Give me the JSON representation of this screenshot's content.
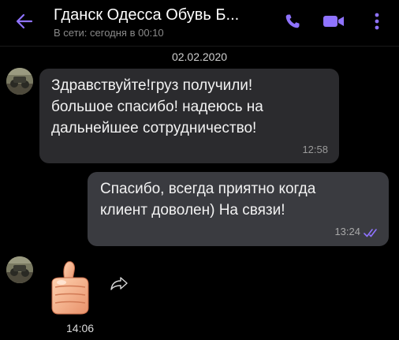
{
  "header": {
    "title": "Гданск Одесса Обувь Б...",
    "status": "В сети: сегодня в 00:10",
    "back_icon": "arrow-left-icon",
    "call_icon": "phone-icon",
    "video_icon": "video-camera-icon",
    "menu_icon": "more-vertical-icon"
  },
  "chat": {
    "date_separator": "02.02.2020",
    "messages": [
      {
        "direction": "incoming",
        "text": "Здравствуйте!груз получили!\nбольшое спасибо! надеюсь на\nдальнейшее сотрудничество!",
        "time": "12:58"
      },
      {
        "direction": "outgoing",
        "text": "Спасибо, всегда приятно когда\nклиент доволен) На связи!",
        "time": "13:24",
        "status_icon": "double-check-icon"
      },
      {
        "direction": "incoming",
        "sticker": "thumbs-up-sticker",
        "share_icon": "share-arrow-icon",
        "time": "14:06"
      }
    ]
  },
  "colors": {
    "accent": "#8f73ff",
    "background": "#000000",
    "incoming_bubble": "#2b2b2e",
    "outgoing_bubble": "#3a3b40"
  }
}
